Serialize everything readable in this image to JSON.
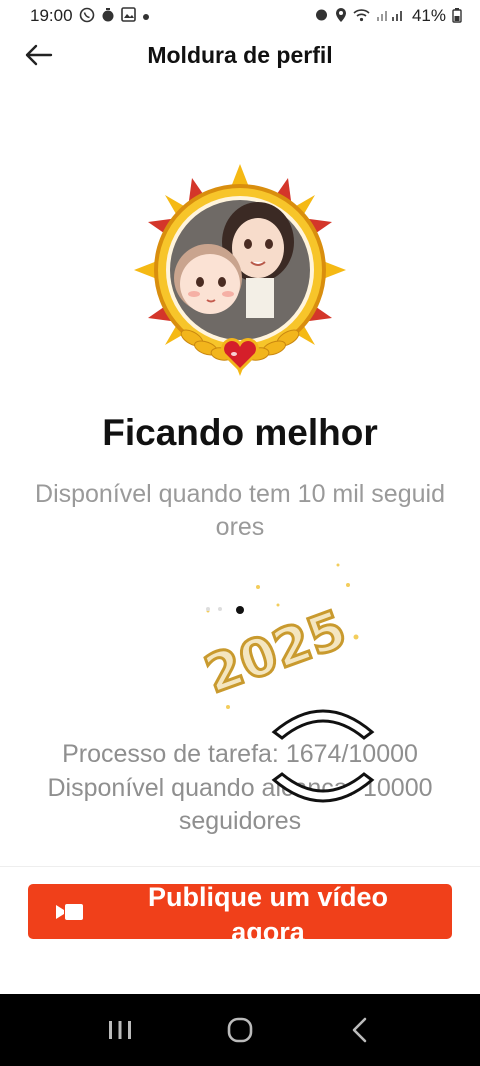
{
  "status_bar": {
    "time": "19:00",
    "battery": "41%",
    "left_icons": [
      "whatsapp-icon",
      "timer-icon",
      "gallery-icon",
      "dot-icon"
    ],
    "right_icons": [
      "alarm-icon",
      "location-icon",
      "wifi-icon",
      "signal-icon",
      "battery-icon"
    ]
  },
  "header": {
    "title": "Moldura de perfil",
    "back_icon": "arrow-left-icon"
  },
  "frame": {
    "title": "Ficando melhor",
    "description": "Disponível quando tem 10 mil seguidores"
  },
  "sticker": {
    "text": "2025"
  },
  "progress": {
    "label": "Processo de tarefa: 1674/10000",
    "current": 1674,
    "total": 10000,
    "requirement": "Disponível quando alcançar 10000 seguidores"
  },
  "publish_button": {
    "label": "Publique um vídeo agora",
    "icon": "video-camera-icon"
  },
  "nav_bar": {
    "items": [
      "recent-apps-icon",
      "home-icon",
      "back-icon"
    ]
  },
  "colors": {
    "accent": "#f0401a",
    "gold": "#f2b51c",
    "muted_text": "#9a9a9a"
  }
}
